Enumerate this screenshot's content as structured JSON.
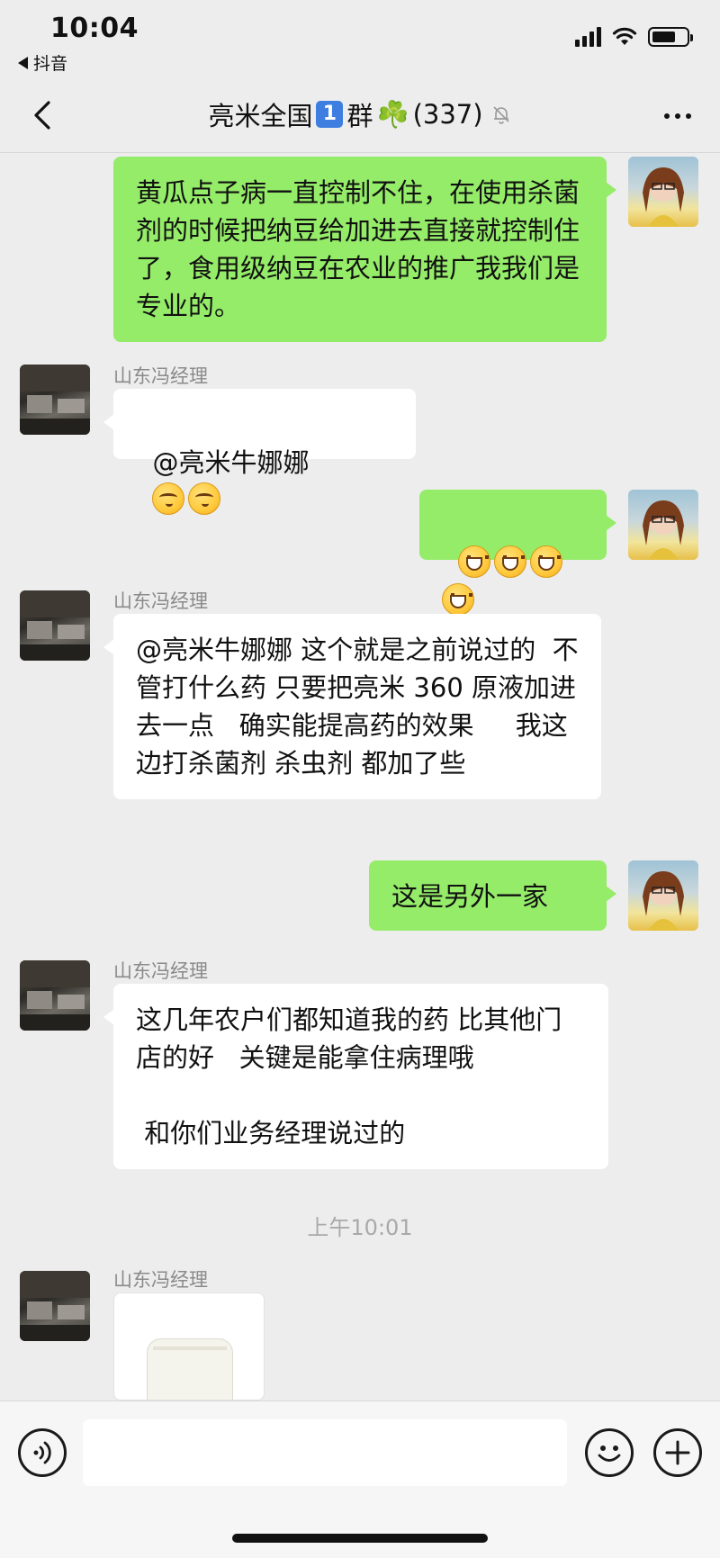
{
  "status_bar": {
    "time": "10:04",
    "back_app": "抖音",
    "battery_level_percent": 70
  },
  "nav": {
    "title_prefix": "亮米全国",
    "title_badge": "1",
    "title_suffix": "群",
    "clover": "☘️",
    "member_count": "(337)"
  },
  "messages": [
    {
      "kind": "outgoing",
      "text": "黄瓜点子病一直控制不住，在使用杀菌剂的时候把纳豆给加进去直接就控制住了，食用级纳豆在农业的推广我我们是专业的。"
    },
    {
      "kind": "incoming",
      "sender": "山东冯经理",
      "text": "@亮米牛娜娜"
    },
    {
      "kind": "outgoing",
      "emoji": [
        "grinning-face",
        "grinning-face",
        "grinning-face",
        "grinning-face"
      ]
    },
    {
      "kind": "incoming",
      "sender": "山东冯经理",
      "text": "@亮米牛娜娜 这个就是之前说过的  不管打什么药 只要把亮米 360 原液加进去一点   确实能提高药的效果     我这边打杀菌剂 杀虫剂 都加了些"
    },
    {
      "kind": "outgoing",
      "text": "这是另外一家"
    },
    {
      "kind": "incoming",
      "sender": "山东冯经理",
      "text": "这几年农户们都知道我的药 比其他门店的好   关键是能拿住病理哦\n\n 和你们业务经理说过的"
    },
    {
      "kind": "timestamp",
      "text": "上午10:01"
    },
    {
      "kind": "incoming-image",
      "sender": "山东冯经理"
    }
  ],
  "input_bar": {
    "placeholder": ""
  }
}
